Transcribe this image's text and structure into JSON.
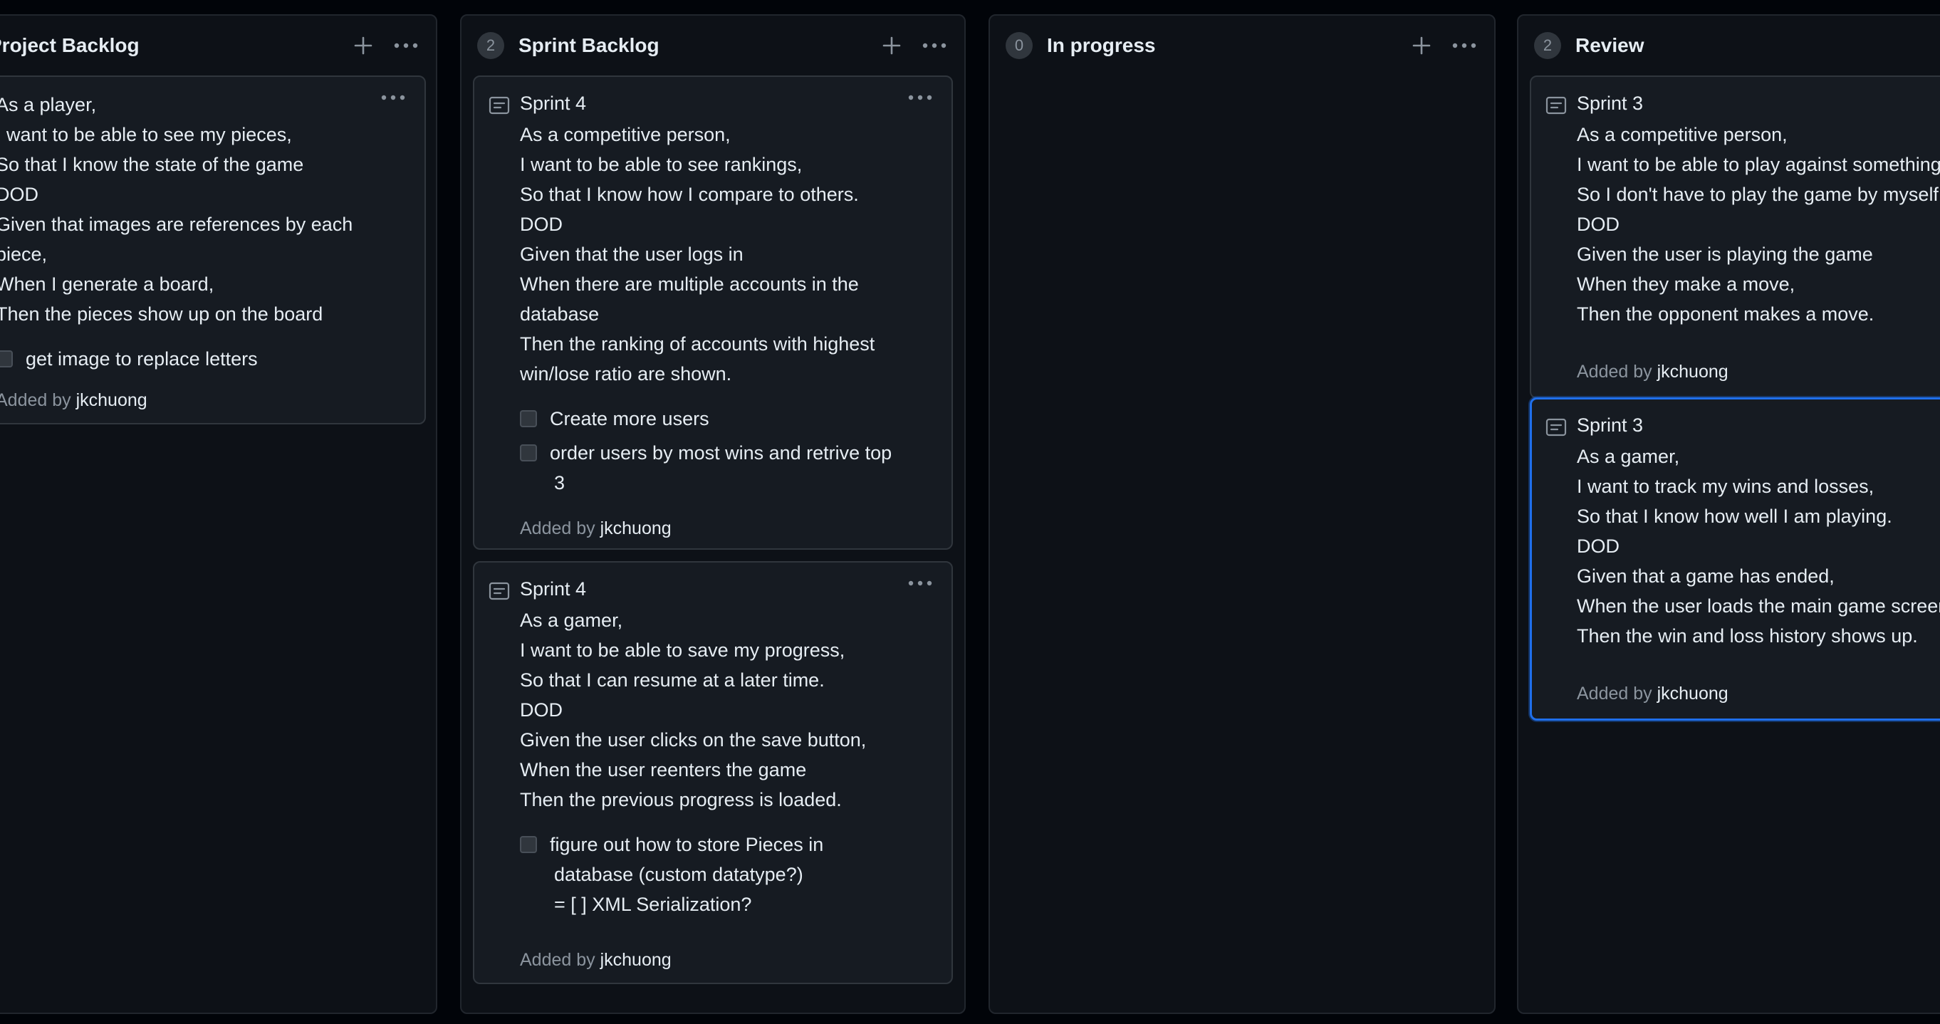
{
  "colors": {
    "background": "#010409",
    "column_bg": "#0d1117",
    "card_bg": "#161b22",
    "border": "#30363d",
    "text": "#e6edf3",
    "muted": "#8b949e",
    "selected_border": "#1f6feb"
  },
  "icons": {
    "add": "plus-icon",
    "menu": "kebab-horizontal-icon",
    "card_type": "note-icon"
  },
  "columns": [
    {
      "title": "Project Backlog",
      "count": "",
      "cards": [
        {
          "title": "",
          "lines": [
            "As a player,",
            "I want to be able to see my pieces,",
            "So that I know the state of the game",
            "DOD",
            "Given that images are references by each",
            "piece,",
            "When I generate a board,",
            "Then the pieces show up on the board"
          ],
          "tasks": [
            {
              "lines": [
                "get image to replace letters"
              ],
              "checked": false
            }
          ],
          "added_by_label": "Added by",
          "added_by_user": "jkchuong"
        }
      ]
    },
    {
      "title": "Sprint Backlog",
      "count": "2",
      "cards": [
        {
          "title": "Sprint 4",
          "lines": [
            "As a competitive person,",
            "I want to be able to see rankings,",
            "So that I know how I compare to others.",
            "DOD",
            "Given that the user logs in",
            "When there are multiple accounts in the",
            "database",
            "Then the ranking of accounts with highest",
            "win/lose ratio are shown."
          ],
          "tasks": [
            {
              "lines": [
                "Create more users"
              ],
              "checked": false
            },
            {
              "lines": [
                "order users by most wins and retrive top",
                "3"
              ],
              "checked": false
            }
          ],
          "added_by_label": "Added by",
          "added_by_user": "jkchuong"
        },
        {
          "title": "Sprint 4",
          "lines": [
            "As a gamer,",
            "I want to be able to save my progress,",
            "So that I can resume at a later time.",
            "DOD",
            "Given the user clicks on the save button,",
            "When the user reenters the game",
            "Then the previous progress is loaded."
          ],
          "tasks": [
            {
              "lines": [
                "figure out how to store Pieces in",
                "database (custom datatype?)",
                "= [ ] XML Serialization?"
              ],
              "checked": false
            }
          ],
          "added_by_label": "Added by",
          "added_by_user": "jkchuong"
        }
      ]
    },
    {
      "title": "In progress",
      "count": "0",
      "cards": []
    },
    {
      "title": "Review",
      "count": "2",
      "cards": [
        {
          "title": "Sprint 3",
          "lines": [
            "As a competitive person,",
            "I want to be able to play against something,",
            "So I don't have to play the game by myself.",
            "DOD",
            "Given the user is playing the game",
            "When they make a move,",
            "Then the opponent makes a move."
          ],
          "tasks": [],
          "added_by_label": "Added by",
          "added_by_user": "jkchuong"
        },
        {
          "title": "Sprint 3",
          "lines": [
            "As a gamer,",
            "I want to track my wins and losses,",
            "So that I know how well I am playing.",
            "DOD",
            "Given that a game has ended,",
            "When the user loads the main game screen,",
            "Then the win and loss history shows up."
          ],
          "tasks": [],
          "added_by_label": "Added by",
          "added_by_user": "jkchuong"
        }
      ]
    }
  ]
}
